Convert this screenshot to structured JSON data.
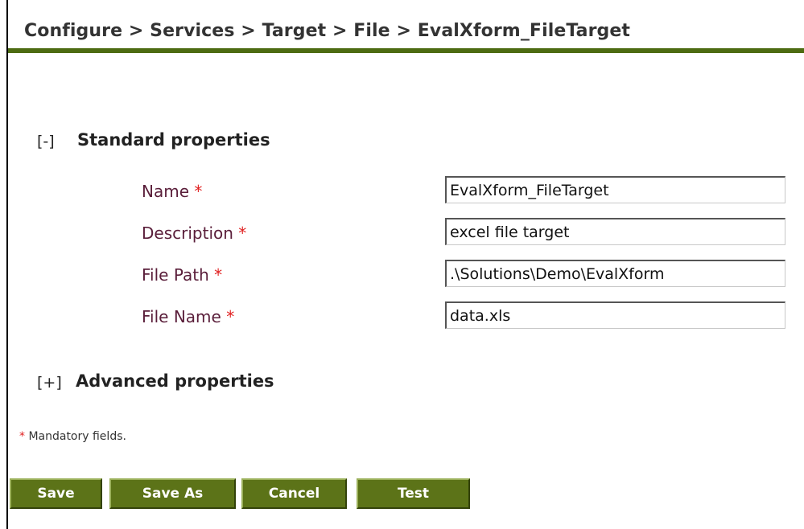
{
  "breadcrumb": "Configure > Services > Target > File > EvalXform_FileTarget",
  "standard_section": {
    "toggle": "[-]",
    "title": "Standard properties"
  },
  "fields": [
    {
      "label": "Name",
      "required_mark": "*",
      "value": "EvalXform_FileTarget"
    },
    {
      "label": "Description",
      "required_mark": "*",
      "value": "excel file target"
    },
    {
      "label": "File Path",
      "required_mark": "*",
      "value": ".\\Solutions\\Demo\\EvalXform"
    },
    {
      "label": "File Name",
      "required_mark": "*",
      "value": "data.xls"
    }
  ],
  "advanced_section": {
    "toggle": "[+]",
    "title": "Advanced properties"
  },
  "mandatory_note": {
    "mark": "*",
    "text": " Mandatory fields."
  },
  "buttons": {
    "save": "Save",
    "save_as": "Save As",
    "cancel": "Cancel",
    "test": "Test"
  },
  "colors": {
    "accent_bar": "#4d6b12",
    "button_bg": "#5c7318",
    "label_text": "#5a1e3a",
    "required": "#e02020"
  }
}
